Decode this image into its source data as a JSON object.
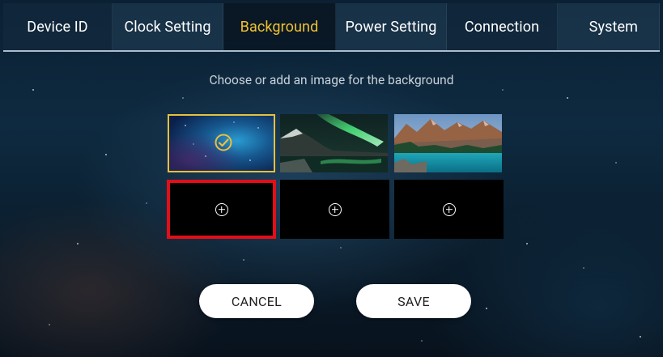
{
  "tabs": [
    {
      "label": "Device ID"
    },
    {
      "label": "Clock Setting"
    },
    {
      "label": "Background"
    },
    {
      "label": "Power Setting"
    },
    {
      "label": "Connection"
    },
    {
      "label": "System"
    }
  ],
  "active_tab": "Background",
  "instruction": "Choose or add an image for the background",
  "images": [
    {
      "icon": "galaxy-image",
      "selected": true
    },
    {
      "icon": "aurora-mountain-image",
      "selected": false
    },
    {
      "icon": "mountain-lake-image",
      "selected": false
    }
  ],
  "add_slots": [
    {
      "icon": "add-circle-icon",
      "highlighted": true
    },
    {
      "icon": "add-circle-icon",
      "highlighted": false
    },
    {
      "icon": "add-circle-icon",
      "highlighted": false
    }
  ],
  "buttons": {
    "cancel_label": "CANCEL",
    "save_label": "SAVE"
  },
  "colors": {
    "active_tab_text": "#f0c230",
    "selected_border": "#e8c13a",
    "highlight_box": "#e30e17",
    "button_bg": "#ffffff"
  }
}
